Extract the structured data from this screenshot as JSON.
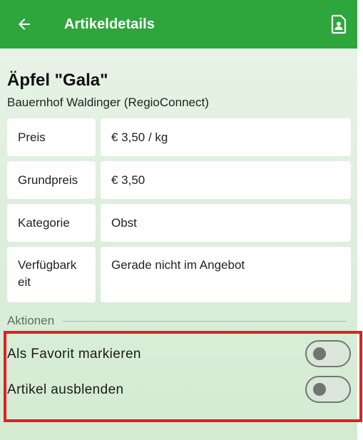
{
  "appbar": {
    "title": "Artikeldetails",
    "back_icon": "arrow-left-icon",
    "profile_icon": "contact-card-icon",
    "color": "#2ea63c"
  },
  "product": {
    "name": "Äpfel \"Gala\"",
    "vendor": "Bauernhof Waldinger (RegioConnect)"
  },
  "details": [
    {
      "label": "Preis",
      "value": "€ 3,50 / kg"
    },
    {
      "label": "Grundpreis",
      "value": "€ 3,50"
    },
    {
      "label": "Kategorie",
      "value": "Obst"
    },
    {
      "label": "Verfügbark\neit",
      "value": "Gerade nicht im Angebot"
    }
  ],
  "actions": {
    "header": "Aktionen",
    "favorite": {
      "label": "Als Favorit markieren",
      "on": false
    },
    "hide": {
      "label": "Artikel ausblenden",
      "on": false
    }
  },
  "colors": {
    "highlight": "#e02020",
    "background": "#dcefdb"
  }
}
